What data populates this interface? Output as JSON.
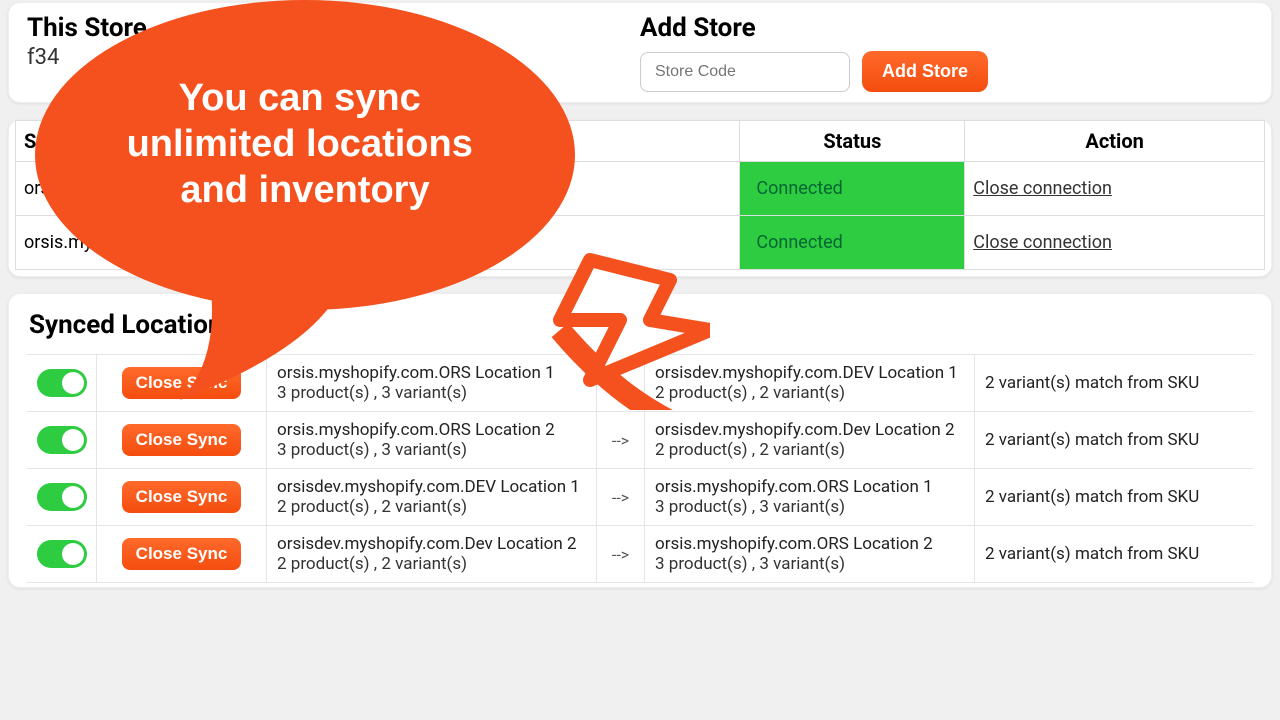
{
  "thisStore": {
    "title": "This Store",
    "code": "f34"
  },
  "addStore": {
    "title": "Add Store",
    "placeholder": "Store Code",
    "button": "Add Store"
  },
  "storesTable": {
    "headers": {
      "sub": "Sub Store",
      "status": "Status",
      "action": "Action"
    },
    "rows": [
      {
        "sub": "orsisdev.myshopify.com",
        "status": "Connected",
        "action": "Close connection"
      },
      {
        "sub": "orsis.myshopify.com",
        "status": "Connected",
        "action": "Close connection"
      }
    ]
  },
  "synced": {
    "title": "Synced Location(s)",
    "closeBtn": "Close Sync",
    "arrow": "-->",
    "rows": [
      {
        "srcA": "orsis.myshopify.com.ORS Location 1",
        "srcB": "3 product(s) , 3 variant(s)",
        "dstA": "orsisdev.myshopify.com.DEV Location 1",
        "dstB": "2 product(s) , 2 variant(s)",
        "match": "2 variant(s) match from SKU"
      },
      {
        "srcA": "orsis.myshopify.com.ORS Location 2",
        "srcB": "3 product(s) , 3 variant(s)",
        "dstA": "orsisdev.myshopify.com.Dev Location 2",
        "dstB": "2 product(s) , 2 variant(s)",
        "match": "2 variant(s) match from SKU"
      },
      {
        "srcA": "orsisdev.myshopify.com.DEV Location 1",
        "srcB": "2 product(s) , 2 variant(s)",
        "dstA": "orsis.myshopify.com.ORS Location 1",
        "dstB": "3 product(s) , 3 variant(s)",
        "match": "2 variant(s) match from SKU"
      },
      {
        "srcA": "orsisdev.myshopify.com.Dev Location 2",
        "srcB": "2 product(s) , 2 variant(s)",
        "dstA": "orsis.myshopify.com.ORS Location 2",
        "dstB": "3 product(s) , 3 variant(s)",
        "match": "2 variant(s) match from SKU"
      }
    ]
  },
  "callout": {
    "text": "You can sync unlimited locations and inventory"
  },
  "colors": {
    "accent": "#f4511e",
    "green": "#2ecc40"
  }
}
